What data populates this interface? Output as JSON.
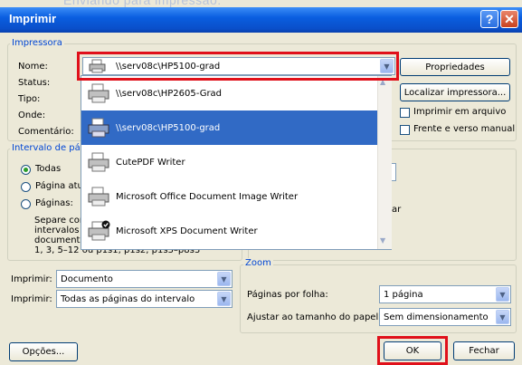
{
  "overlay": {
    "text1": "Enviando para impressao:",
    "text2": "x"
  },
  "window": {
    "title": "Imprimir",
    "help_label": "?",
    "close_label": "✕"
  },
  "printer_group": {
    "label": "Impressora",
    "name_label": "Nome:",
    "selected": "\\\\serv08c\\HP5100-grad",
    "status_label": "Status:",
    "type_label": "Tipo:",
    "where_label": "Onde:",
    "comment_label": "Comentário:",
    "properties_button": "Propriedades",
    "find_printer_button": "Localizar impressora...",
    "print_to_file": "Imprimir em arquivo",
    "duplex": "Frente e verso manual"
  },
  "printer_list": [
    {
      "name": "\\\\serv08c\\HP2605-Grad",
      "icon": "printer-icon",
      "selected": false
    },
    {
      "name": "\\\\serv08c\\HP5100-grad",
      "icon": "printer-icon",
      "selected": true
    },
    {
      "name": "CutePDF Writer",
      "icon": "printer-icon",
      "selected": false
    },
    {
      "name": "Microsoft Office Document Image Writer",
      "icon": "printer-icon",
      "selected": false
    },
    {
      "name": "Microsoft XPS Document Writer",
      "icon": "default-printer-icon",
      "selected": false
    }
  ],
  "range_group": {
    "label": "Intervalo de pá",
    "all": "Todas",
    "current_page": "Página atu",
    "pages": "Páginas:",
    "help_line1": "Separe com",
    "help_line2": "intervalos",
    "help_line3": "documento",
    "help_line4": "1, 3, 5–12 ou p1s1, p1s2, p1s3–p8s3",
    "side_text": "ar"
  },
  "print_what": {
    "label": "Imprimir:",
    "value": "Documento"
  },
  "print_pages": {
    "label": "Imprimir:",
    "value": "Todas as páginas do intervalo"
  },
  "zoom": {
    "label": "Zoom",
    "pages_per_sheet_label": "Páginas por folha:",
    "pages_per_sheet_value": "1 página",
    "scale_label": "Ajustar ao tamanho do papel:",
    "scale_value": "Sem dimensionamento"
  },
  "footer": {
    "options_button": "Opções...",
    "ok_button": "OK",
    "close_button": "Fechar"
  },
  "colors": {
    "accent": "#316ac5",
    "highlight": "#e0101a",
    "label_blue": "#0046d5"
  }
}
